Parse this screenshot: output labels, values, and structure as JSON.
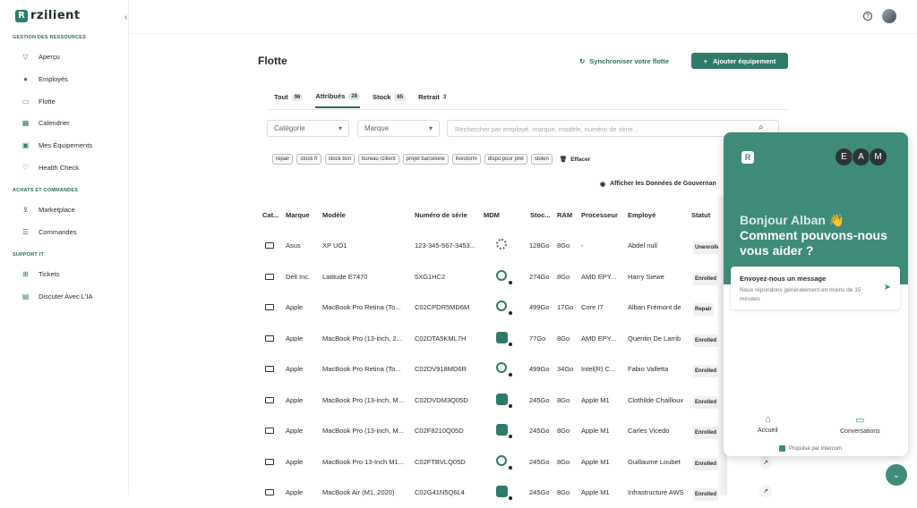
{
  "brand": {
    "logo_letter": "R",
    "logo_text": "rzilient"
  },
  "sidebar": {
    "sections": [
      {
        "title": "GESTION DES RESSOURCES",
        "items": [
          {
            "label": "Aperçu",
            "icon": "filter-icon"
          },
          {
            "label": "Employés",
            "icon": "user-icon"
          },
          {
            "label": "Flotte",
            "icon": "device-icon"
          },
          {
            "label": "Calendrier",
            "icon": "calendar-icon"
          },
          {
            "label": "Mes Équipements",
            "icon": "monitor-icon"
          },
          {
            "label": "Health Check",
            "icon": "shield-icon"
          }
        ]
      },
      {
        "title": "ACHATS ET COMMANDES",
        "items": [
          {
            "label": "Marketplace",
            "icon": "cart-icon"
          },
          {
            "label": "Commandes",
            "icon": "list-icon"
          }
        ]
      },
      {
        "title": "SUPPORT IT",
        "items": [
          {
            "label": "Tickets",
            "icon": "ticket-icon"
          },
          {
            "label": "Discuter Avec L'IA",
            "icon": "chat-icon"
          }
        ]
      }
    ]
  },
  "header": {
    "title": "Flotte",
    "sync_label": "Synchroniser votre flotte",
    "add_label": "Ajouter équipement"
  },
  "tabs": [
    {
      "label": "Tout",
      "count": "96"
    },
    {
      "label": "Attribués",
      "count": "28"
    },
    {
      "label": "Stock",
      "count": "65"
    },
    {
      "label": "Retrait",
      "count": "3"
    }
  ],
  "filters": {
    "category_placeholder": "Catégorie",
    "brand_placeholder": "Marque",
    "search_placeholder": "Rechercher par employé, marque, modèle, numéro de série..."
  },
  "tags": [
    "repair",
    "stock fr",
    "stock bcn",
    "bureau rzilient",
    "projet barcelone",
    "livestorm",
    "dispo pour pret",
    "stolen"
  ],
  "clear_label": "Effacer",
  "gov_label": "Afficher les Données de Gouvernan",
  "columns": [
    "Cat...",
    "Marque",
    "Modèle",
    "Numéro de série",
    "MDM",
    "Stoc...",
    "RAM",
    "Processeur",
    "Employé",
    "Statut"
  ],
  "rows": [
    {
      "brand": "Asus",
      "model": "XP UO1",
      "serial": "123-345-567-3453...",
      "mdm": "spin",
      "storage": "128Go",
      "ram": "8Go",
      "cpu": "-",
      "employee": "Abdel null",
      "status": "Unenrolled"
    },
    {
      "brand": "Dell Inc.",
      "model": "Latitude E7470",
      "serial": "5XG1HC2",
      "mdm": "b",
      "storage": "274Go",
      "ram": "8Go",
      "cpu": "AMD EPY...",
      "employee": "Harry Siewe",
      "status": "Enrolled"
    },
    {
      "brand": "Apple",
      "model": "MacBook Pro Retina (To...",
      "serial": "C02CPDR5MD6M",
      "mdm": "b",
      "storage": "499Go",
      "ram": "17Go",
      "cpu": "Core I7",
      "employee": "Alban Frémont de",
      "status": "Repair"
    },
    {
      "brand": "Apple",
      "model": "MacBook Pro (13-inch, 2...",
      "serial": "C02DTA5KML7H",
      "mdm": "a",
      "storage": "77Go",
      "ram": "8Go",
      "cpu": "AMD EPY...",
      "employee": "Quentin De Larrib",
      "status": "Enrolled"
    },
    {
      "brand": "Apple",
      "model": "MacBook Pro Retina (To...",
      "serial": "C02DV918MD6R",
      "mdm": "b",
      "storage": "499Go",
      "ram": "34Go",
      "cpu": "Intel(R) C...",
      "employee": "Fabio Valletta",
      "status": "Enrolled"
    },
    {
      "brand": "Apple",
      "model": "MacBook Pro (13-inch, M...",
      "serial": "C02DVDM3Q05D",
      "mdm": "a",
      "storage": "245Go",
      "ram": "8Go",
      "cpu": "Apple M1",
      "employee": "Clothilde Chailloux",
      "status": "Enrolled"
    },
    {
      "brand": "Apple",
      "model": "MacBook Pro (13-inch, M...",
      "serial": "C02F8210Q05D",
      "mdm": "a",
      "storage": "245Go",
      "ram": "8Go",
      "cpu": "Apple M1",
      "employee": "Carles Vicedo",
      "status": "Enrolled"
    },
    {
      "brand": "Apple",
      "model": "MacBook Pro 13-Inch M1...",
      "serial": "C02FTBVLQ05D",
      "mdm": "b",
      "storage": "245Go",
      "ram": "8Go",
      "cpu": "Apple M1",
      "employee": "Guillaume Loubet",
      "status": "Enrolled"
    },
    {
      "brand": "Apple",
      "model": "MacBook Air (M1, 2020)",
      "serial": "C02G41N5Q6L4",
      "mdm": "a",
      "storage": "245Go",
      "ram": "8Go",
      "cpu": "Apple M1",
      "employee": "Infrastructure AWS",
      "status": "Enrolled"
    }
  ],
  "chat": {
    "avatars": [
      "E",
      "A",
      "M"
    ],
    "greeting": "Bonjour Alban 👋",
    "question": "Comment pouvons-nous vous aider ?",
    "message_title": "Envoyez-nous un message",
    "message_sub": "Nous répondons généralement en moins de 15 minutes",
    "nav_home": "Accueil",
    "nav_conv": "Conversations",
    "powered": "Propulsé par Intercom"
  }
}
